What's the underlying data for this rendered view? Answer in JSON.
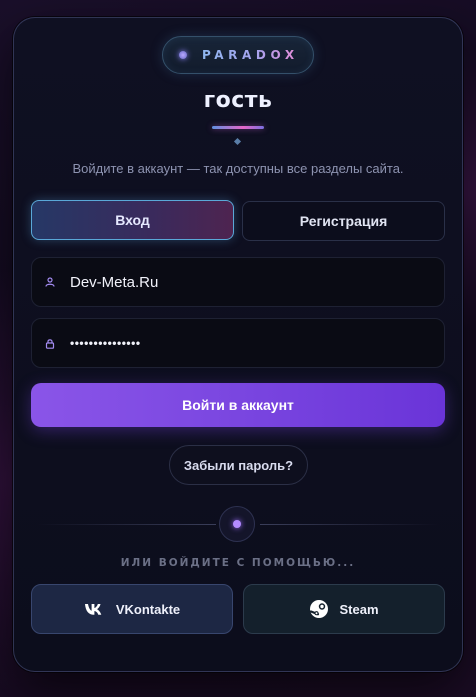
{
  "brand": {
    "name": "PARADOX"
  },
  "header": {
    "title": "гость",
    "subtitle": "Войдите в аккаунт — так доступны все разделы сайта."
  },
  "tabs": [
    {
      "label": "Вход",
      "active": true
    },
    {
      "label": "Регистрация",
      "active": false
    }
  ],
  "form": {
    "login": {
      "value": "Dev-Meta.Ru",
      "icon": "user-icon"
    },
    "password": {
      "value": "•••••••••••••••",
      "icon": "lock-icon"
    },
    "submit_label": "Войти в аккаунт",
    "forgot_label": "Забыли пароль?"
  },
  "social": {
    "divider_text": "ИЛИ ВОЙДИТЕ С ПОМОЩЬЮ...",
    "buttons": [
      {
        "label": "VKontakte",
        "icon": "vk-icon"
      },
      {
        "label": "Steam",
        "icon": "steam-icon"
      }
    ]
  },
  "colors": {
    "accent": "#7a46e0",
    "brand_gradient_end": "#e58bd7",
    "tab_active_border": "#5aa8d8"
  }
}
